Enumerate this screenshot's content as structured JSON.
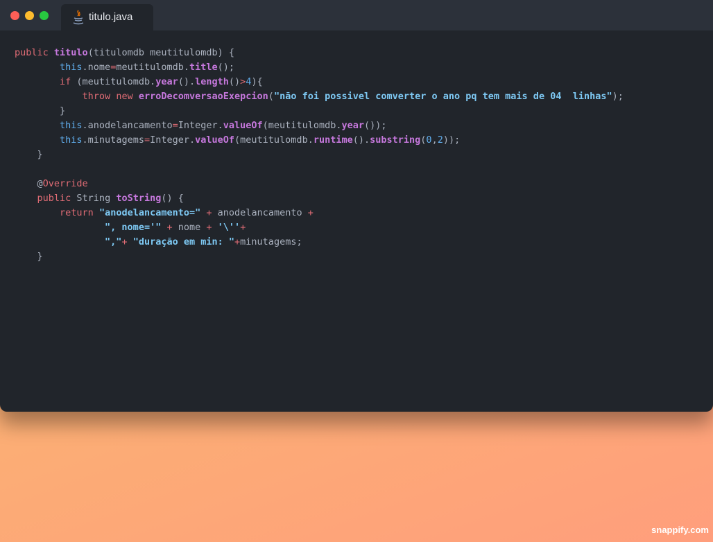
{
  "window": {
    "tab": {
      "label": "titulo.java",
      "icon": "java-icon"
    },
    "traffic_lights": {
      "close": "#fe5f57",
      "minimize": "#febc2e",
      "zoom": "#28c840"
    }
  },
  "code_lines": [
    [
      [
        "kw",
        "public"
      ],
      [
        "plain",
        " "
      ],
      [
        "decl",
        "titulo"
      ],
      [
        "plain",
        "(titulomdb meutitulomdb) {"
      ]
    ],
    [
      [
        "plain",
        "        "
      ],
      [
        "this",
        "this"
      ],
      [
        "plain",
        ".nome"
      ],
      [
        "op",
        "="
      ],
      [
        "plain",
        "meutitulomdb."
      ],
      [
        "fn",
        "title"
      ],
      [
        "plain",
        "();"
      ]
    ],
    [
      [
        "plain",
        "        "
      ],
      [
        "kw",
        "if"
      ],
      [
        "plain",
        " (meutitulomdb."
      ],
      [
        "fn",
        "year"
      ],
      [
        "plain",
        "()."
      ],
      [
        "fn",
        "length"
      ],
      [
        "plain",
        "()"
      ],
      [
        "op",
        ">"
      ],
      [
        "num",
        "4"
      ],
      [
        "plain",
        "){"
      ]
    ],
    [
      [
        "plain",
        "            "
      ],
      [
        "kw",
        "throw"
      ],
      [
        "plain",
        " "
      ],
      [
        "kw",
        "new"
      ],
      [
        "plain",
        " "
      ],
      [
        "fn",
        "erroDecomversaoExepcion"
      ],
      [
        "plain",
        "("
      ],
      [
        "str",
        "\"não foi possivel comverter o ano pq tem mais de 04  linhas\""
      ],
      [
        "plain",
        ");"
      ]
    ],
    [
      [
        "plain",
        "        }"
      ]
    ],
    [
      [
        "plain",
        "        "
      ],
      [
        "this",
        "this"
      ],
      [
        "plain",
        ".anodelancamento"
      ],
      [
        "op",
        "="
      ],
      [
        "plain",
        "Integer."
      ],
      [
        "fn",
        "valueOf"
      ],
      [
        "plain",
        "(meutitulomdb."
      ],
      [
        "fn",
        "year"
      ],
      [
        "plain",
        "());"
      ]
    ],
    [
      [
        "plain",
        "        "
      ],
      [
        "this",
        "this"
      ],
      [
        "plain",
        ".minutagems"
      ],
      [
        "op",
        "="
      ],
      [
        "plain",
        "Integer."
      ],
      [
        "fn",
        "valueOf"
      ],
      [
        "plain",
        "(meutitulomdb."
      ],
      [
        "fn",
        "runtime"
      ],
      [
        "plain",
        "()."
      ],
      [
        "fn",
        "substring"
      ],
      [
        "plain",
        "("
      ],
      [
        "num",
        "0"
      ],
      [
        "plain",
        ","
      ],
      [
        "num",
        "2"
      ],
      [
        "plain",
        "));"
      ]
    ],
    [
      [
        "plain",
        "    }"
      ]
    ],
    [
      [
        "plain",
        ""
      ]
    ],
    [
      [
        "plain",
        "    @"
      ],
      [
        "anno",
        "Override"
      ]
    ],
    [
      [
        "plain",
        "    "
      ],
      [
        "kw",
        "public"
      ],
      [
        "plain",
        " String "
      ],
      [
        "fn",
        "toString"
      ],
      [
        "plain",
        "() {"
      ]
    ],
    [
      [
        "plain",
        "        "
      ],
      [
        "kw",
        "return"
      ],
      [
        "plain",
        " "
      ],
      [
        "str",
        "\"anodelancamento=\""
      ],
      [
        "plain",
        " "
      ],
      [
        "op",
        "+"
      ],
      [
        "plain",
        " anodelancamento "
      ],
      [
        "op",
        "+"
      ]
    ],
    [
      [
        "plain",
        "                "
      ],
      [
        "str",
        "\", nome='\""
      ],
      [
        "plain",
        " "
      ],
      [
        "op",
        "+"
      ],
      [
        "plain",
        " nome "
      ],
      [
        "op",
        "+"
      ],
      [
        "plain",
        " "
      ],
      [
        "str",
        "'\\''"
      ],
      [
        "op",
        "+"
      ]
    ],
    [
      [
        "plain",
        "                "
      ],
      [
        "str",
        "\",\""
      ],
      [
        "op",
        "+"
      ],
      [
        "plain",
        " "
      ],
      [
        "str",
        "\"duração em min: \""
      ],
      [
        "op",
        "+"
      ],
      [
        "plain",
        "minutagems;"
      ]
    ],
    [
      [
        "plain",
        "    }"
      ]
    ]
  ],
  "watermark": "snappify.com"
}
